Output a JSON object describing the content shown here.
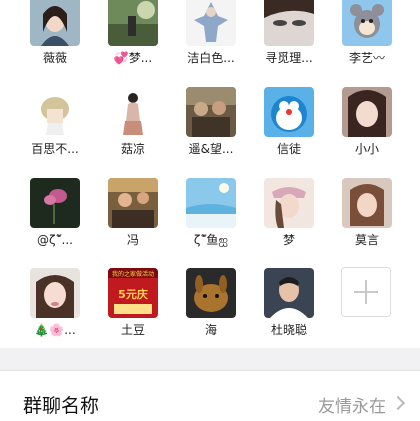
{
  "members": [
    {
      "name": "薇薇"
    },
    {
      "name": "💞梦..."
    },
    {
      "name": "洁白色..."
    },
    {
      "name": "寻觅理..."
    },
    {
      "name": "李艺〰"
    },
    {
      "name": "百思不..."
    },
    {
      "name": "菇凉"
    },
    {
      "name": "遥&望..."
    },
    {
      "name": "信徒"
    },
    {
      "name": "小小"
    },
    {
      "name": "@ζ῀ั..."
    },
    {
      "name": "冯"
    },
    {
      "name": "ζ῀ั鱼ஐ"
    },
    {
      "name": "梦"
    },
    {
      "name": "莫言"
    },
    {
      "name": "🎄🌸..."
    },
    {
      "name": "土豆"
    },
    {
      "name": "海"
    },
    {
      "name": "杜晓聪"
    }
  ],
  "add_member_icon": "plus-icon",
  "group_name_row": {
    "label": "群聊名称",
    "value": "友情永在",
    "chevron_icon": "chevron-right-icon"
  },
  "avatar_texts": {
    "red_banner_top": "我的之家做活动",
    "red_banner_big": "5元庆"
  },
  "colors": {
    "separator": "#f1f1f4",
    "value_text": "#9a9a9a"
  }
}
